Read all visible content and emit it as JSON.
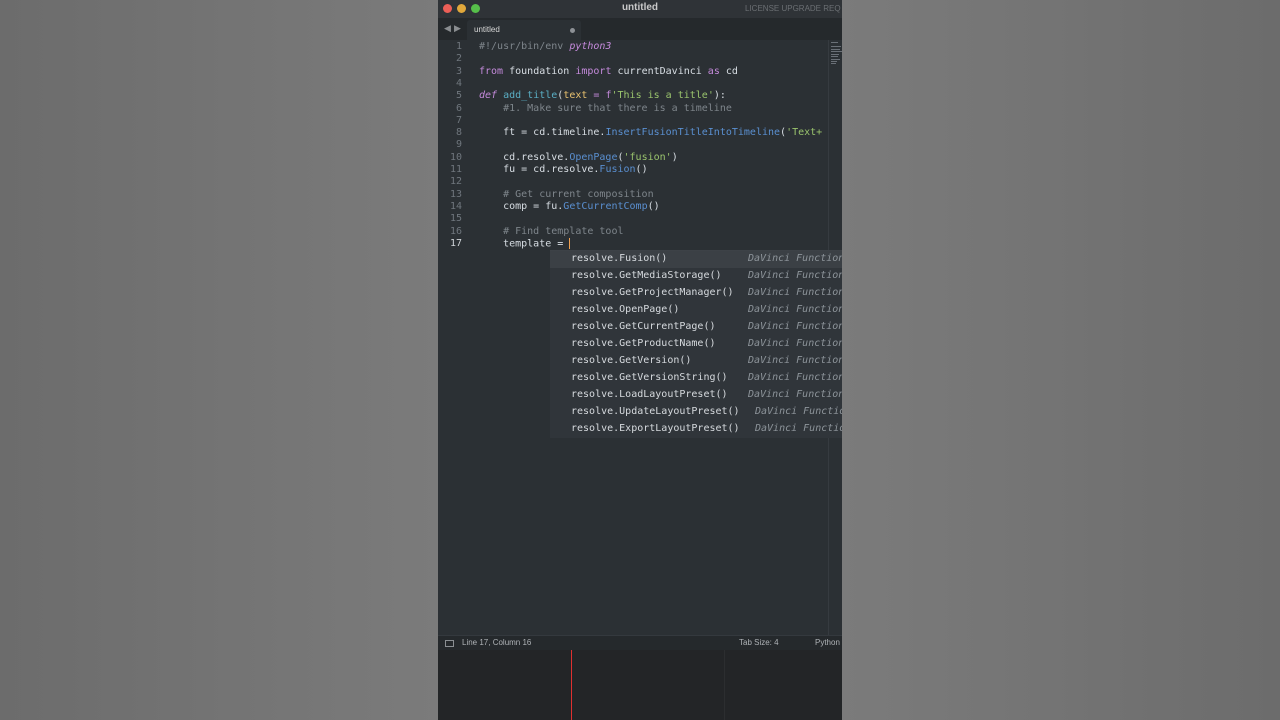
{
  "window": {
    "title": "untitled",
    "license_text": "LICENSE UPGRADE REQ"
  },
  "tabs": [
    {
      "label": "untitled",
      "modified": true
    }
  ],
  "editor": {
    "line_numbers": [
      "1",
      "2",
      "3",
      "4",
      "5",
      "6",
      "7",
      "8",
      "9",
      "10",
      "11",
      "12",
      "13",
      "14",
      "15",
      "16",
      "17"
    ],
    "current_line": "17",
    "code": {
      "l1_a": "#!/usr/bin/env ",
      "l1_b": "python3",
      "l3_from": "from",
      "l3_mod": " foundation ",
      "l3_import": "import",
      "l3_name": " currentDavinci ",
      "l3_as": "as",
      "l3_alias": " cd",
      "l5_def": "def",
      "l5_sp": " ",
      "l5_fn": "add_title",
      "l5_open": "(",
      "l5_param": "text",
      "l5_eq": " = ",
      "l5_f": "f",
      "l5_str": "'This is a title'",
      "l5_close": "):",
      "l6": "    #1. Make sure that there is a timeline",
      "l8_a": "    ft = cd.timeline.",
      "l8_m": "InsertFusionTitleIntoTimeline",
      "l8_open": "(",
      "l8_s": "'Text+",
      "l10_a": "    cd.resolve.",
      "l10_m": "OpenPage",
      "l10_open": "(",
      "l10_s": "'fusion'",
      "l10_close": ")",
      "l11_a": "    fu = cd.resolve.",
      "l11_m": "Fusion",
      "l11_b": "()",
      "l13": "    # Get current composition",
      "l14_a": "    comp = fu.",
      "l14_m": "GetCurrentComp",
      "l14_b": "()",
      "l16": "    # Find template tool",
      "l17_a": "    template = "
    }
  },
  "autocomplete": {
    "selected_index": 0,
    "items": [
      {
        "name": "resolve.Fusion()",
        "type": "DaVinci Function"
      },
      {
        "name": "resolve.GetMediaStorage()",
        "type": "DaVinci Function"
      },
      {
        "name": "resolve.GetProjectManager()",
        "type": "DaVinci Function"
      },
      {
        "name": "resolve.OpenPage()",
        "type": "DaVinci Function"
      },
      {
        "name": "resolve.GetCurrentPage()",
        "type": "DaVinci Function"
      },
      {
        "name": "resolve.GetProductName()",
        "type": "DaVinci Function"
      },
      {
        "name": "resolve.GetVersion()",
        "type": "DaVinci Function"
      },
      {
        "name": "resolve.GetVersionString()",
        "type": "DaVinci Function"
      },
      {
        "name": "resolve.LoadLayoutPreset()",
        "type": "DaVinci Function"
      },
      {
        "name": "resolve.UpdateLayoutPreset()",
        "type": "DaVinci Function"
      },
      {
        "name": "resolve.ExportLayoutPreset()",
        "type": "DaVinci Function"
      }
    ]
  },
  "status_bar": {
    "position": "Line 17, Column 16",
    "tab_size": "Tab Size: 4",
    "syntax": "Python"
  },
  "colors": {
    "keyword": "#c48adb",
    "function": "#5aaec4",
    "method": "#5a8fd0",
    "string": "#9ac46d",
    "comment": "#7e858b",
    "param": "#e8c16f",
    "playhead": "#e03030"
  },
  "icons": [
    "close-window-icon",
    "minimize-window-icon",
    "zoom-window-icon",
    "back-arrow-icon",
    "forward-arrow-icon",
    "sidebar-toggle-icon"
  ]
}
